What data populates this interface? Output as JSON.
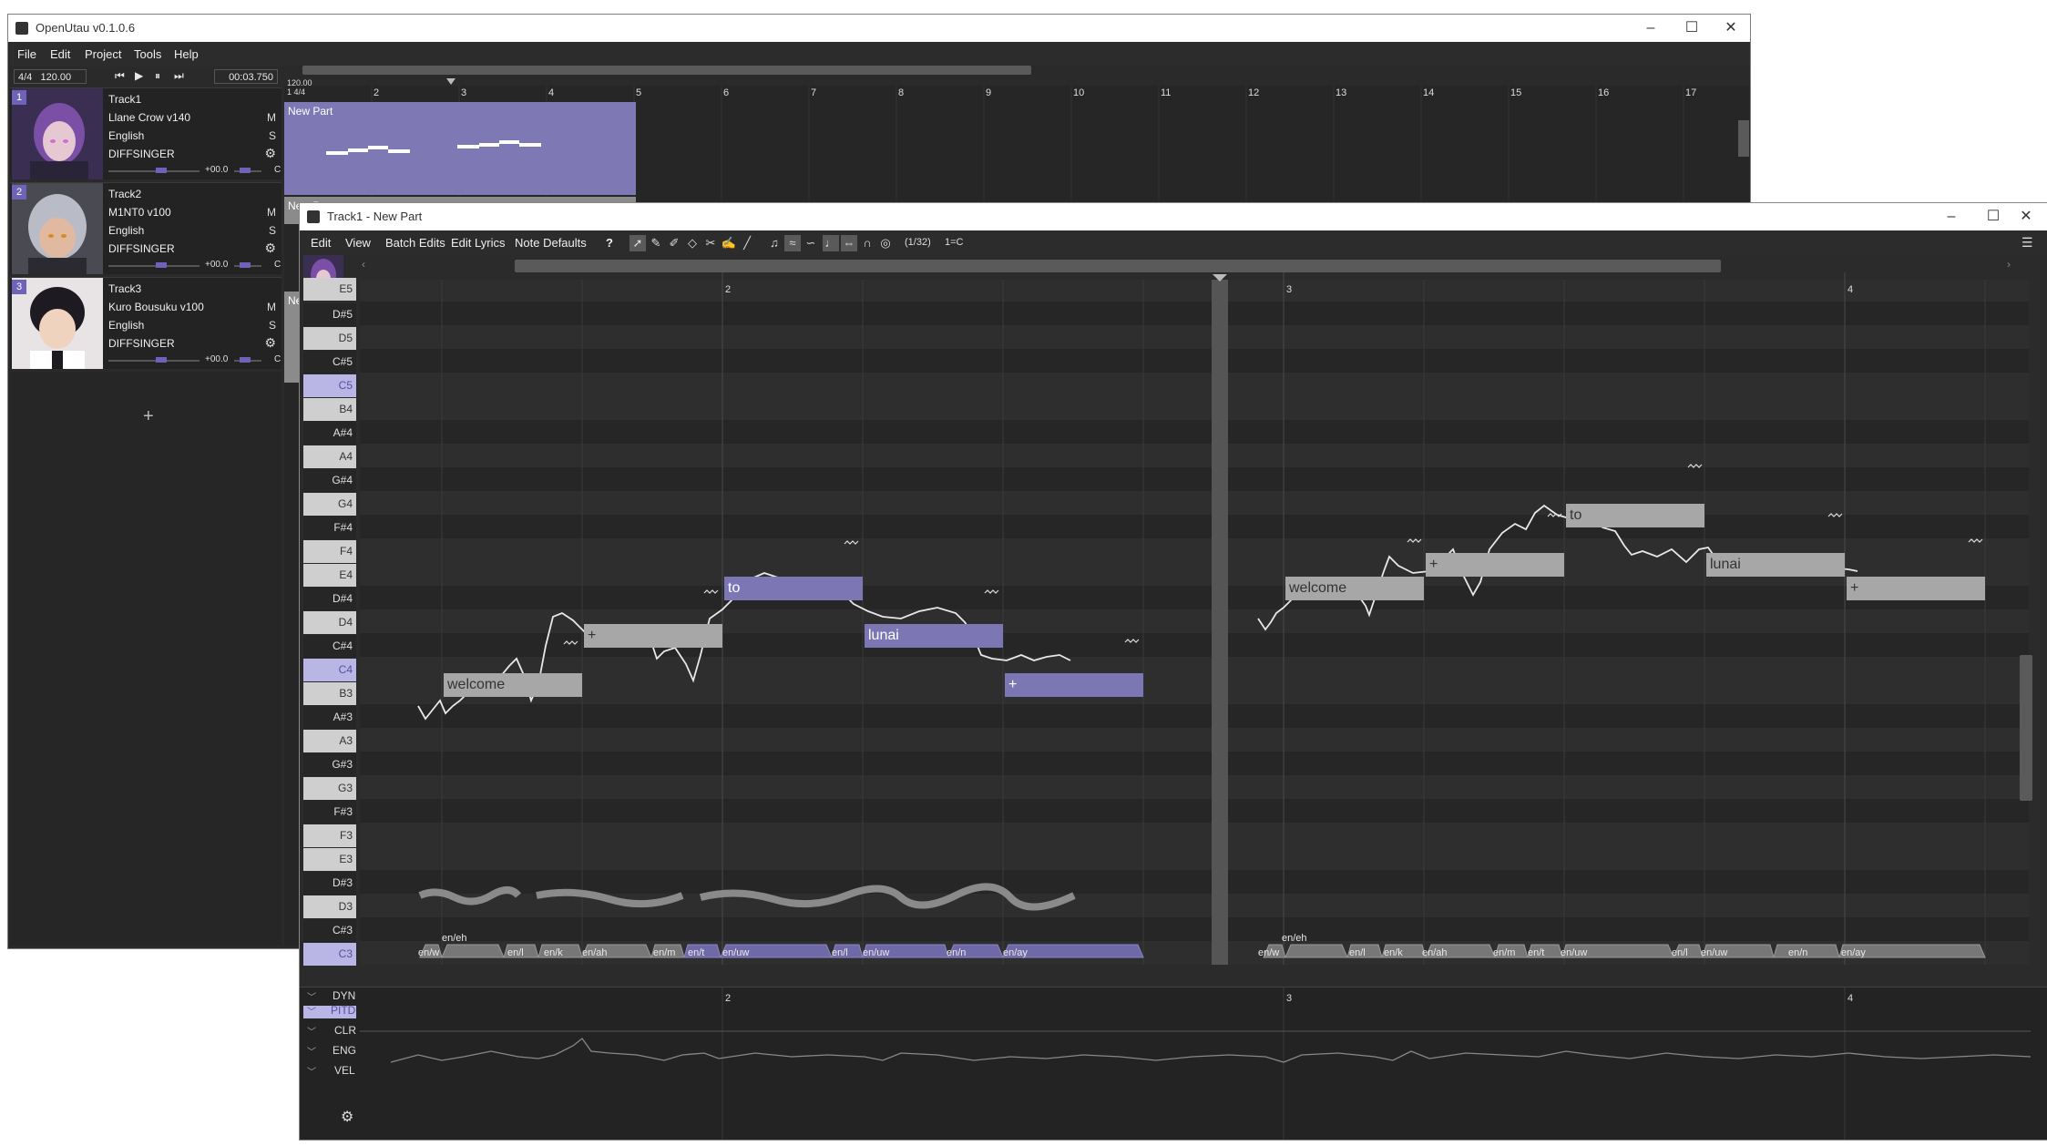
{
  "main_window": {
    "title": "OpenUtau v0.1.0.6",
    "menu": [
      "File",
      "Edit",
      "Project",
      "Tools",
      "Help"
    ],
    "time_signature": "4/4",
    "bpm": "120.00",
    "time_display": "00:03.750",
    "ruler_header_bpm": "120.00",
    "ruler_header_sig": "1 4/4",
    "ruler_numbers": [
      "2",
      "3",
      "4",
      "5",
      "6",
      "7",
      "8",
      "9",
      "10",
      "11",
      "12",
      "13",
      "14",
      "15",
      "16",
      "17"
    ],
    "add_track": "+"
  },
  "tracks": [
    {
      "number": "1",
      "name": "Track1",
      "singer": "Llane Crow v140",
      "language": "English",
      "renderer": "DIFFSINGER",
      "mute": "M",
      "solo": "S",
      "volume": "+00.0",
      "pan": "C",
      "accent": "#2a2040"
    },
    {
      "number": "2",
      "name": "Track2",
      "singer": "M1NT0 v100",
      "language": "English",
      "renderer": "DIFFSINGER",
      "mute": "M",
      "solo": "S",
      "volume": "+00.0",
      "pan": "C",
      "accent": "#c7a640"
    },
    {
      "number": "3",
      "name": "Track3",
      "singer": "Kuro Bousuku v100",
      "language": "English",
      "renderer": "DIFFSINGER",
      "mute": "M",
      "solo": "S",
      "volume": "+00.0",
      "pan": "C",
      "accent": "#d13b4a"
    }
  ],
  "parts": [
    {
      "name": "New Part"
    },
    {
      "name": "New Part"
    },
    {
      "name": "Ne"
    }
  ],
  "piano_roll": {
    "title": "Track1 - New Part",
    "menu": [
      "Edit",
      "View",
      "Batch Edits",
      "Edit Lyrics",
      "Note Defaults",
      "?"
    ],
    "snap": "(1/32)",
    "key": "1=C",
    "ruler_numbers": [
      "2",
      "3",
      "4"
    ],
    "keys": [
      "E5",
      "D#5",
      "D5",
      "C#5",
      "C5",
      "B4",
      "A#4",
      "A4",
      "G#4",
      "G4",
      "F#4",
      "F4",
      "E4",
      "D#4",
      "D4",
      "C#4",
      "C4",
      "B3",
      "A#3",
      "A3",
      "G#3",
      "G3",
      "F#3",
      "F3",
      "E3",
      "D#3",
      "D3",
      "C#3",
      "C3"
    ],
    "notes_left": [
      "welcome",
      "+",
      "to",
      "lunai",
      "+"
    ],
    "notes_right": [
      "welcome",
      "+",
      "to",
      "lunai",
      "+"
    ],
    "phonemes_left": [
      "en/w",
      "en/eh",
      "en/l",
      "en/k",
      "en/ah",
      "en/m",
      "en/t",
      "en/uw",
      "en/l",
      "en/uw",
      "en/n",
      "en/ay"
    ],
    "phonemes_right": [
      "en/w",
      "en/eh",
      "en/l",
      "en/k",
      "en/ah",
      "en/m",
      "en/t",
      "en/uw",
      "en/l",
      "en/uw",
      "en/n",
      "en/ay"
    ],
    "expressions": [
      "DYN",
      "PITD",
      "CLR",
      "ENG",
      "VEL"
    ]
  },
  "colors": {
    "accent": "#6e63b8",
    "selected_note": "#7c76b4",
    "unselected_note": "#a7a7a7"
  }
}
